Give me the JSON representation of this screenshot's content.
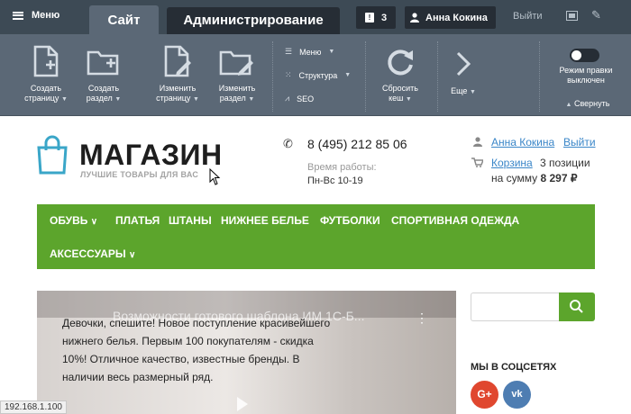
{
  "admin_bar": {
    "menu_label": "Меню",
    "tabs": [
      {
        "label": "Сайт"
      },
      {
        "label": "Администрирование"
      }
    ],
    "notifications_count": "3",
    "user_name": "Анна Кокина",
    "exit_label": "Выйти"
  },
  "panel": {
    "buttons": [
      {
        "line1": "Создать",
        "line2": "страницу"
      },
      {
        "line1": "Создать",
        "line2": "раздел"
      },
      {
        "line1": "Изменить",
        "line2": "страницу"
      },
      {
        "line1": "Изменить",
        "line2": "раздел"
      }
    ],
    "menu_list": [
      "Меню",
      "Структура",
      "SEO"
    ],
    "cache": {
      "line1": "Сбросить",
      "line2": "кеш"
    },
    "more_label": "Еще",
    "edit_mode": {
      "line1": "Режим правки",
      "line2": "выключен",
      "on": false
    },
    "collapse_label": "Свернуть"
  },
  "header": {
    "logo_title": "МАГАЗИН",
    "logo_subtitle": "ЛУЧШИЕ ТОВАРЫ ДЛЯ ВАС",
    "phone": "8 (495) 212 85 06",
    "hours_label": "Время работы:",
    "hours_value": "Пн-Вс 10-19",
    "user_link": "Анна Кокина",
    "logout_link": "Выйти",
    "cart_link": "Корзина",
    "cart_count": "3 позиции",
    "cart_sum_label": "на сумму",
    "cart_sum_value": "8 297 ₽"
  },
  "nav": {
    "items": [
      "ОБУВЬ",
      "ПЛАТЬЯ",
      "ШТАНЫ",
      "НИЖНЕЕ БЕЛЬЕ",
      "ФУТБОЛКИ",
      "СПОРТИВНАЯ ОДЕЖДА",
      "АКСЕССУАРЫ"
    ]
  },
  "slider": {
    "video_title": "Возможности готового шаблона ИМ 1С-Б...",
    "text": "Девочки, спешите! Новое поступление красивейшего нижнего белья. Первым 100 покупателям - скидка 10%! Отличное качество, известные бренды. В наличии весь размерный ряд."
  },
  "sidebar": {
    "social_title": "МЫ В СОЦСЕТЯХ",
    "gplus_label": "G+",
    "vk_label": "vk"
  },
  "status_url": "192.168.1.100",
  "colors": {
    "brand_green": "#5ca52c",
    "admin_bg": "#3d4a55",
    "panel_bg": "#5b6876",
    "link": "#3a86c8"
  }
}
